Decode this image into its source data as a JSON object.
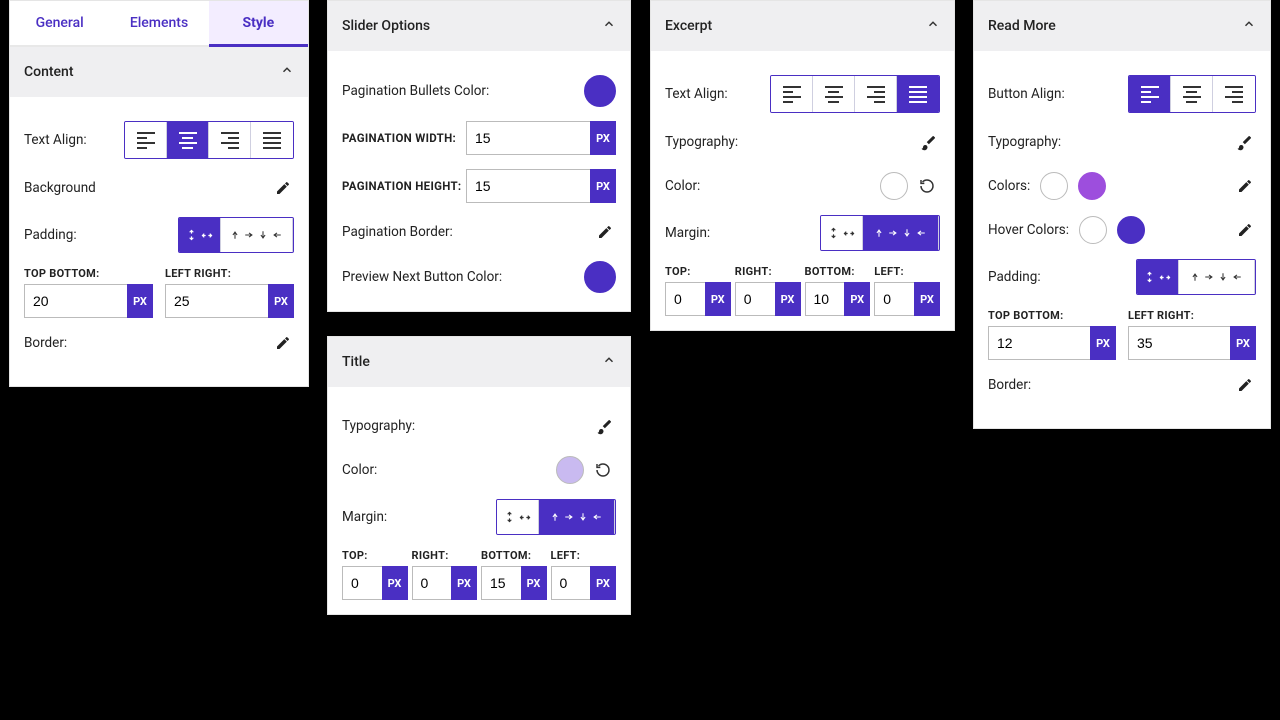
{
  "unit_label": "PX",
  "tabs": {
    "general": "General",
    "elements": "Elements",
    "style": "Style"
  },
  "content": {
    "header": "Content",
    "text_align_label": "Text Align:",
    "background_label": "Background",
    "padding_label": "Padding:",
    "tb_label": "TOP BOTTOM:",
    "lr_label": "LEFT RIGHT:",
    "tb_value": "20",
    "lr_value": "25",
    "border_label": "Border:"
  },
  "slider": {
    "header": "Slider Options",
    "bullets_label": "Pagination Bullets Color:",
    "bullets_color": "#4a2fc3",
    "pw_label": "PAGINATION WIDTH:",
    "pw_value": "15",
    "ph_label": "PAGINATION HEIGHT:",
    "ph_value": "15",
    "border_label": "Pagination Border:",
    "nextbtn_label": "Preview Next Button Color:",
    "nextbtn_color": "#4a2fc3"
  },
  "title": {
    "header": "Title",
    "typo_label": "Typography:",
    "color_label": "Color:",
    "color_value": "#c9baf0",
    "margin_label": "Margin:",
    "top_label": "TOP:",
    "right_label": "RIGHT:",
    "bottom_label": "BOTTOM:",
    "left_label": "LEFT:",
    "top": "0",
    "right": "0",
    "bottom": "15",
    "left": "0"
  },
  "excerpt": {
    "header": "Excerpt",
    "text_align_label": "Text Align:",
    "typo_label": "Typography:",
    "color_label": "Color:",
    "color_value": "#ffffff",
    "margin_label": "Margin:",
    "top_label": "TOP:",
    "right_label": "RIGHT:",
    "bottom_label": "BOTTOM:",
    "left_label": "LEFT:",
    "top": "0",
    "right": "0",
    "bottom": "10",
    "left": "0"
  },
  "readmore": {
    "header": "Read More",
    "align_label": "Button Align:",
    "typo_label": "Typography:",
    "colors_label": "Colors:",
    "colors_a": "#ffffff",
    "colors_b": "#9d4edd",
    "hover_label": "Hover Colors:",
    "hover_a": "#ffffff",
    "hover_b": "#4a2fc3",
    "padding_label": "Padding:",
    "tb_label": "TOP BOTTOM:",
    "lr_label": "LEFT RIGHT:",
    "tb_value": "12",
    "lr_value": "35",
    "border_label": "Border:"
  }
}
